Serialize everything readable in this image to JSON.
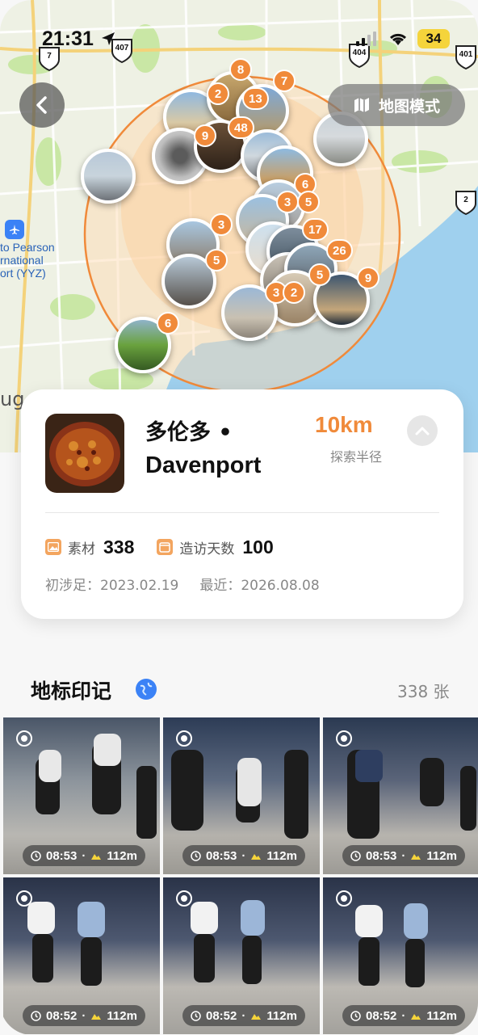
{
  "status": {
    "time": "21:31",
    "battery": "34"
  },
  "nav": {
    "back_icon": "chevron-left-icon",
    "map_mode_label": "地图模式"
  },
  "map": {
    "highway_shields": [
      "7",
      "407",
      "404",
      "401",
      "2"
    ],
    "airport_label_lines": [
      "to Pearson",
      "rnational",
      "ort (YYZ)"
    ],
    "edge_label": "ug",
    "cluster_badges": [
      "8",
      "7",
      "13",
      "2",
      "48",
      "9",
      "6",
      "3",
      "5",
      "3",
      "17",
      "26",
      "5",
      "5",
      "3",
      "2",
      "9",
      "6"
    ]
  },
  "place": {
    "name_line1": "多伦多 •",
    "name_line2": "Davenport",
    "radius_value": "10km",
    "radius_label": "探索半径",
    "materials_label": "素材",
    "materials_value": "338",
    "visit_days_label": "造访天数",
    "visit_days_value": "100",
    "first_visit": "初涉足：2023.02.19",
    "latest_visit": "最近：2026.08.08"
  },
  "gallery": {
    "title": "地标印记",
    "count": "338 张",
    "items": [
      {
        "time": "08:53",
        "distance": "112m"
      },
      {
        "time": "08:53",
        "distance": "112m"
      },
      {
        "time": "08:53",
        "distance": "112m"
      },
      {
        "time": "08:52",
        "distance": "112m"
      },
      {
        "time": "08:52",
        "distance": "112m"
      },
      {
        "time": "08:52",
        "distance": "112m"
      }
    ]
  },
  "colors": {
    "accent": "#f08a3a",
    "map_water": "#9fd0ee",
    "map_land": "#eef1e4"
  }
}
